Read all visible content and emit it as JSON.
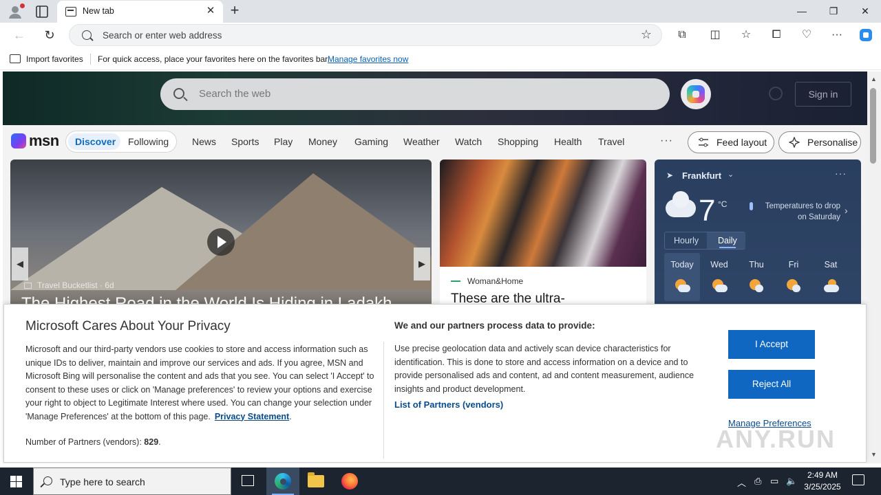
{
  "browser": {
    "tab_title": "New tab",
    "address_placeholder": "Search or enter web address",
    "favorites_bar": {
      "import_label": "Import favorites",
      "message": "For quick access, place your favorites here on the favorites bar.",
      "link": "Manage favorites now"
    }
  },
  "msn": {
    "search_placeholder": "Search the web",
    "sign_in": "Sign in",
    "logo": "msn",
    "feed_tabs": [
      "Discover",
      "Following"
    ],
    "categories": [
      "News",
      "Sports",
      "Play",
      "Money",
      "Gaming",
      "Weather",
      "Watch",
      "Shopping",
      "Health",
      "Travel"
    ],
    "more": "···",
    "feed_layout": "Feed layout",
    "personalise": "Personalise",
    "main_story": {
      "source": "Travel Bucketlist",
      "age": "6d",
      "headline": "The Highest Road in the World Is Hiding in Ladakh"
    },
    "mid_story": {
      "source": "Woman&Home",
      "headline": "These are the ultra-"
    },
    "weather": {
      "location": "Frankfurt",
      "temperature": "7",
      "unit": "°C",
      "message": "Temperatures to drop on Saturday",
      "toggle": [
        "Hourly",
        "Daily"
      ],
      "forecast": [
        "Today",
        "Wed",
        "Thu",
        "Fri",
        "Sat"
      ]
    }
  },
  "privacy": {
    "title": "Microsoft Cares About Your Privacy",
    "body": "Microsoft and our third-party vendors use cookies to store and access information such as unique IDs to deliver, maintain and improve our services and ads. If you agree, MSN and Microsoft Bing will personalise the content and ads that you see. You can select 'I Accept' to consent to these uses or click on 'Manage preferences' to review your options and exercise your right to object to Legitimate Interest where used.  You can change your selection under 'Manage Preferences' at the bottom of this page.",
    "privacy_link": "Privacy Statement",
    "partners_label": "Number of Partners (vendors):",
    "partners_count": "829",
    "right_heading": "We and our partners process data to provide:",
    "right_body": "Use precise geolocation data and actively scan device characteristics for identification. This is done to store and access information on a device and to provide personalised ads and content, ad and content measurement, audience insights and product development.",
    "list_link": "List of Partners (vendors)",
    "accept": "I Accept",
    "reject": "Reject All",
    "manage": "Manage Preferences"
  },
  "watermark": "ANY.RUN",
  "taskbar": {
    "search_placeholder": "Type here to search",
    "time": "2:49 AM",
    "date": "3/25/2025"
  }
}
